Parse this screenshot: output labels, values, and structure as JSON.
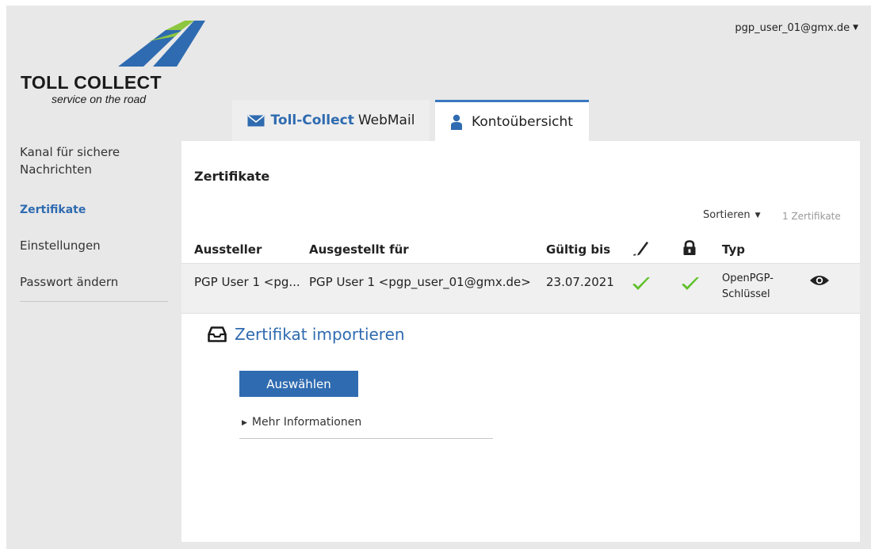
{
  "brand": {
    "name": "TOLL COLLECT",
    "tagline": "service on the road",
    "colors": {
      "blue": "#2f6bb0",
      "green": "#8dc63f",
      "text": "#1a1a1a"
    }
  },
  "user": {
    "email": "pgp_user_01@gmx.de"
  },
  "tabs": [
    {
      "brand": "Toll-Collect",
      "label": "WebMail",
      "icon": "mail-icon"
    },
    {
      "label": "Kontoübersicht",
      "icon": "user-icon",
      "active": true
    }
  ],
  "sidebar": {
    "items": [
      {
        "label": "Kanal für sichere Nachrichten"
      },
      {
        "label": "Zertifikate",
        "active": true
      },
      {
        "label": "Einstellungen"
      },
      {
        "label": "Passwort ändern"
      }
    ]
  },
  "main": {
    "title": "Zertifikate",
    "sort_label": "Sortieren",
    "count": "1 Zertifikate",
    "table": {
      "headers": {
        "issuer": "Aussteller",
        "issued_to": "Ausgestellt für",
        "valid_until": "Gültig bis",
        "sign_icon": "pen-icon",
        "encrypt_icon": "lock-icon",
        "type": "Typ"
      },
      "rows": [
        {
          "issuer": "PGP User 1 <pg...",
          "issued_to": "PGP User 1 <pgp_user_01@gmx.de>",
          "valid_until": "23.07.2021",
          "type_line1": "OpenPGP-",
          "type_line2": "Schlüssel",
          "sign_ok": true,
          "encrypt_ok": true
        }
      ]
    },
    "import": {
      "title": "Zertifikat importieren",
      "button": "Auswählen",
      "more": "Mehr Informationen"
    }
  }
}
